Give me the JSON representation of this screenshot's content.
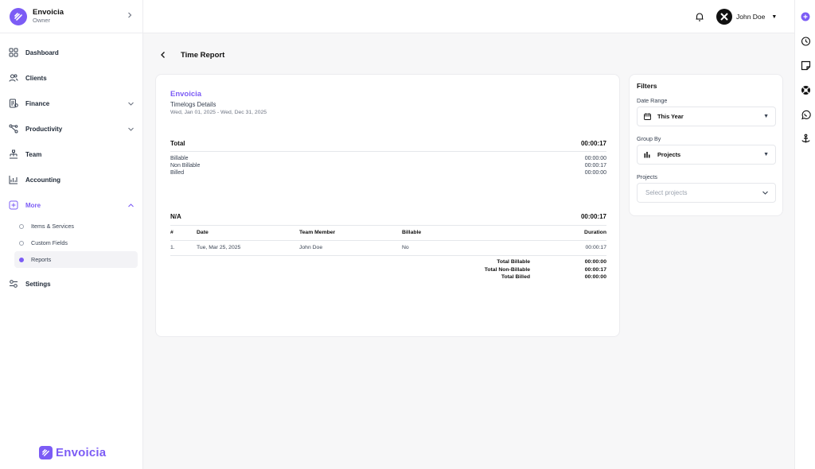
{
  "org": {
    "name": "Envoicia",
    "role": "Owner"
  },
  "sidebar": {
    "items": [
      {
        "label": "Dashboard",
        "icon": "grid-icon"
      },
      {
        "label": "Clients",
        "icon": "users-icon"
      },
      {
        "label": "Finance",
        "icon": "receipt-icon"
      },
      {
        "label": "Productivity",
        "icon": "workflow-icon"
      },
      {
        "label": "Team",
        "icon": "org-chart-icon"
      },
      {
        "label": "Accounting",
        "icon": "chart-icon"
      },
      {
        "label": "More",
        "icon": "plus-square-icon"
      },
      {
        "label": "Settings",
        "icon": "sliders-icon"
      }
    ],
    "more_items": [
      {
        "label": "Items & Services"
      },
      {
        "label": "Custom Fields"
      },
      {
        "label": "Reports"
      }
    ]
  },
  "brand": {
    "name": "Envoicia"
  },
  "topbar": {
    "user_name": "John Doe"
  },
  "page": {
    "title": "Time Report"
  },
  "report": {
    "company": "Envoicia",
    "subtitle": "Timelogs Details",
    "date_range": "Wed, Jan 01, 2025 - Wed, Dec 31, 2025",
    "total_label": "Total",
    "total_value": "00:00:17",
    "breakdown": [
      {
        "label": "Billable",
        "value": "00:00:00"
      },
      {
        "label": "Non Billable",
        "value": "00:00:17"
      },
      {
        "label": "Billed",
        "value": "00:00:00"
      }
    ],
    "group_label": "N/A",
    "group_value": "00:00:17",
    "columns": [
      "#",
      "Date",
      "Team Member",
      "Billable",
      "Duration"
    ],
    "rows": [
      [
        "1.",
        "Tue, Mar 25, 2025",
        "John Doe",
        "No",
        "00:00:17"
      ]
    ],
    "totals": [
      {
        "label": "Total Billable",
        "value": "00:00:00"
      },
      {
        "label": "Total Non-Billable",
        "value": "00:00:17"
      },
      {
        "label": "Total Billed",
        "value": "00:00:00"
      }
    ]
  },
  "filters": {
    "title": "Filters",
    "date_range_label": "Date Range",
    "date_range_value": "This Year",
    "group_by_label": "Group By",
    "group_by_value": "Projects",
    "projects_label": "Projects",
    "projects_placeholder": "Select projects"
  },
  "colors": {
    "accent": "#7c5cf5",
    "text": "#1f2937",
    "border": "#ececef"
  }
}
